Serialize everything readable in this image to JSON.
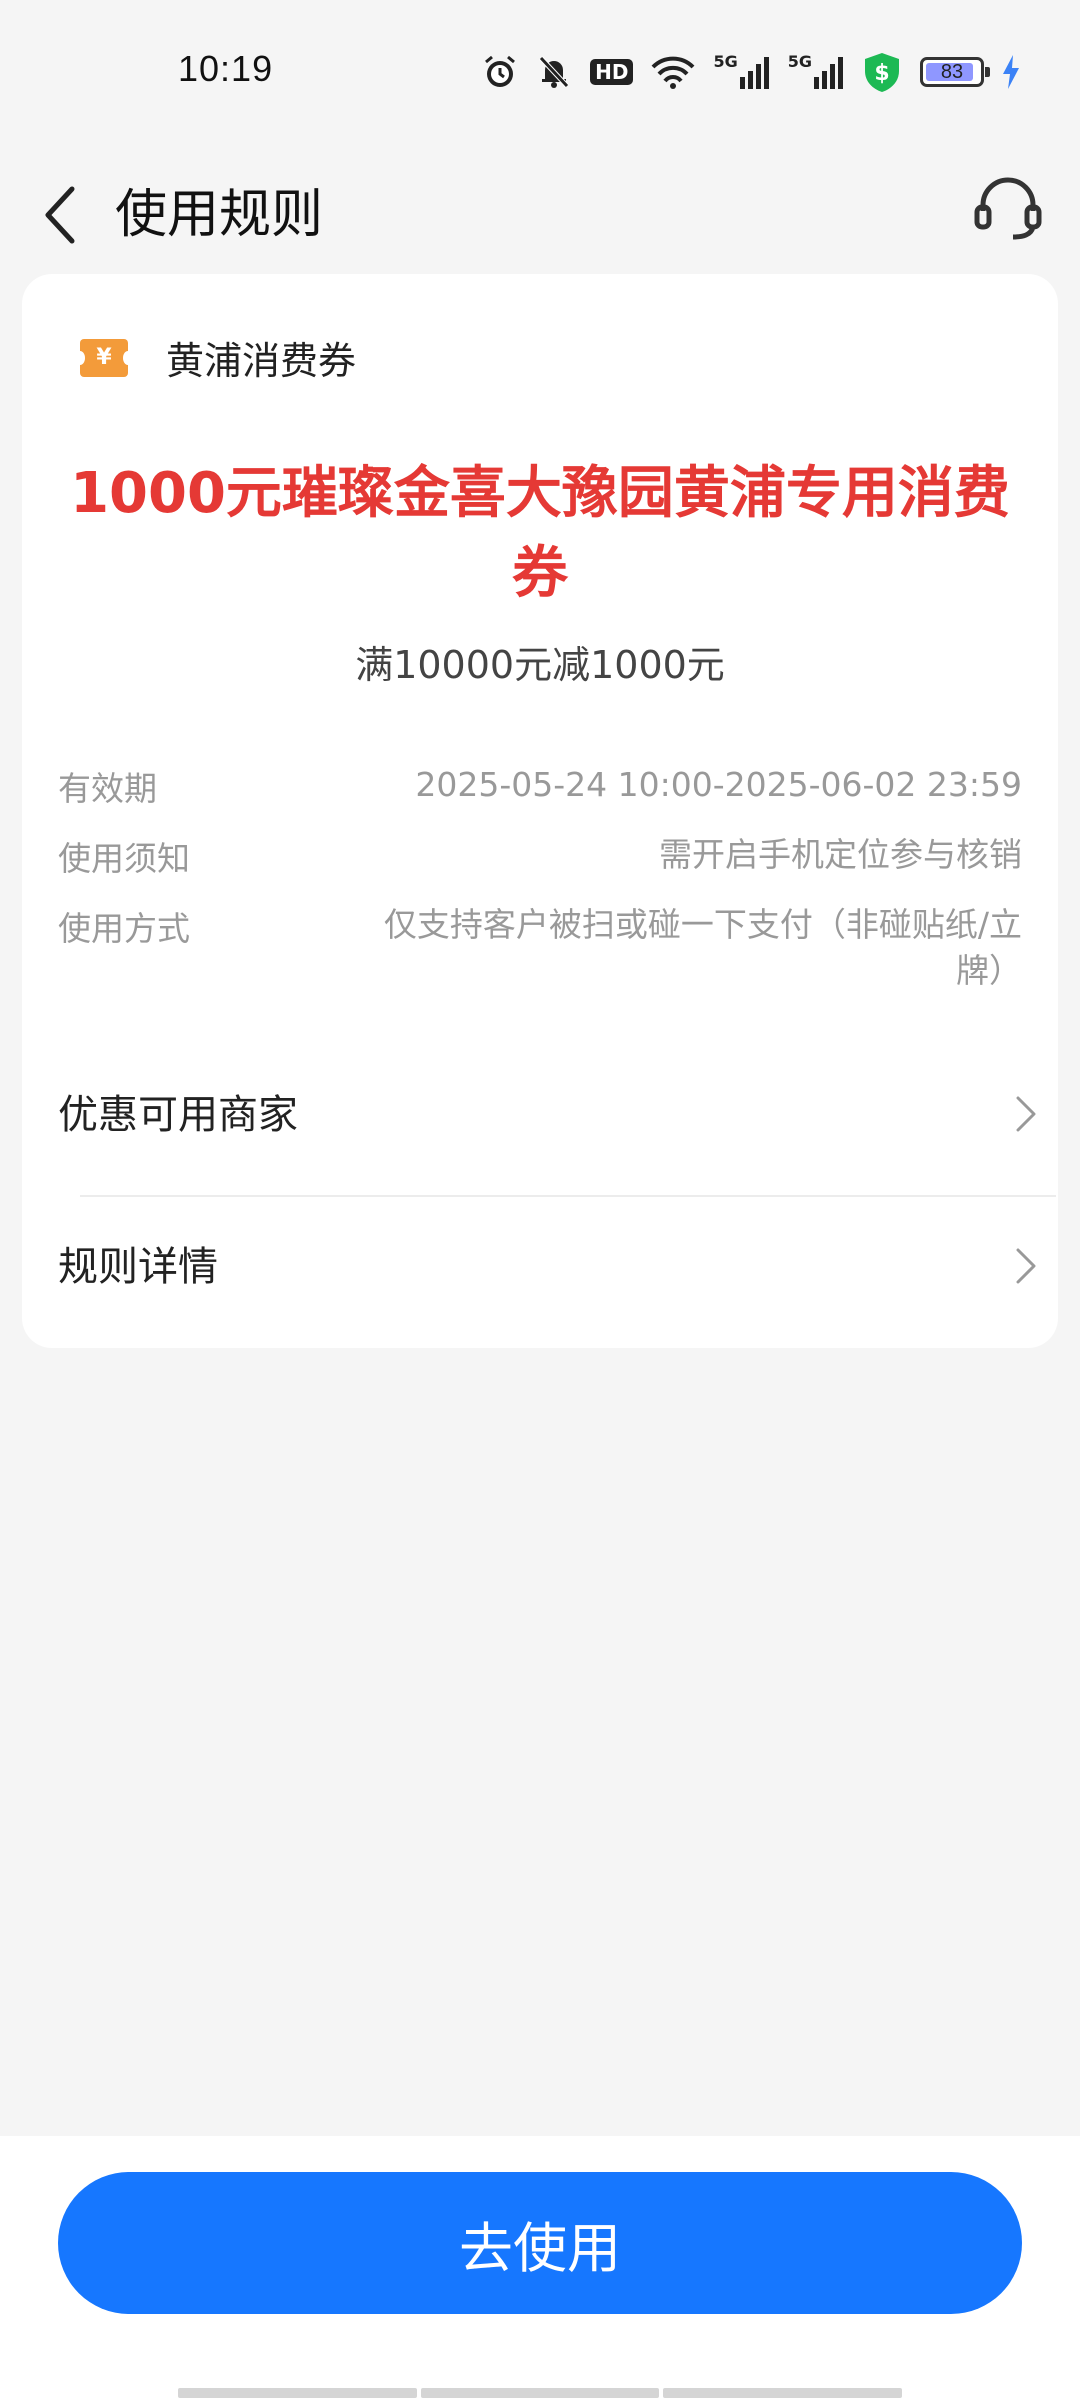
{
  "status_bar": {
    "time": "10:19",
    "hd_label": "HD",
    "signal1_label": "5G",
    "signal2_label": "5G",
    "battery_level": "83",
    "colors": {
      "security_shield": "#1db954",
      "battery_fill": "#8f97ff",
      "charging_bolt": "#3b82f6"
    }
  },
  "header": {
    "title": "使用规则",
    "back_icon": "chevron-left-icon",
    "service_icon": "headset-icon"
  },
  "coupon": {
    "category": "黄浦消费券",
    "icon_glyph": "¥",
    "title": "1000元璀璨金喜大豫园黄浦专用消费券",
    "condition": "满10000元减1000元",
    "details": [
      {
        "label": "有效期",
        "value": "2025-05-24 10:00-2025-06-02 23:59"
      },
      {
        "label": "使用须知",
        "value": "需开启手机定位参与核销"
      },
      {
        "label": "使用方式",
        "value": "仅支持客户被扫或碰一下支付（非碰贴纸/立牌）"
      }
    ],
    "links": [
      {
        "label": "优惠可用商家"
      },
      {
        "label": "规则详情"
      }
    ],
    "colors": {
      "title": "#e53935",
      "icon": "#f39b3a"
    }
  },
  "actions": {
    "use_button": "去使用",
    "button_color": "#1677ff"
  }
}
